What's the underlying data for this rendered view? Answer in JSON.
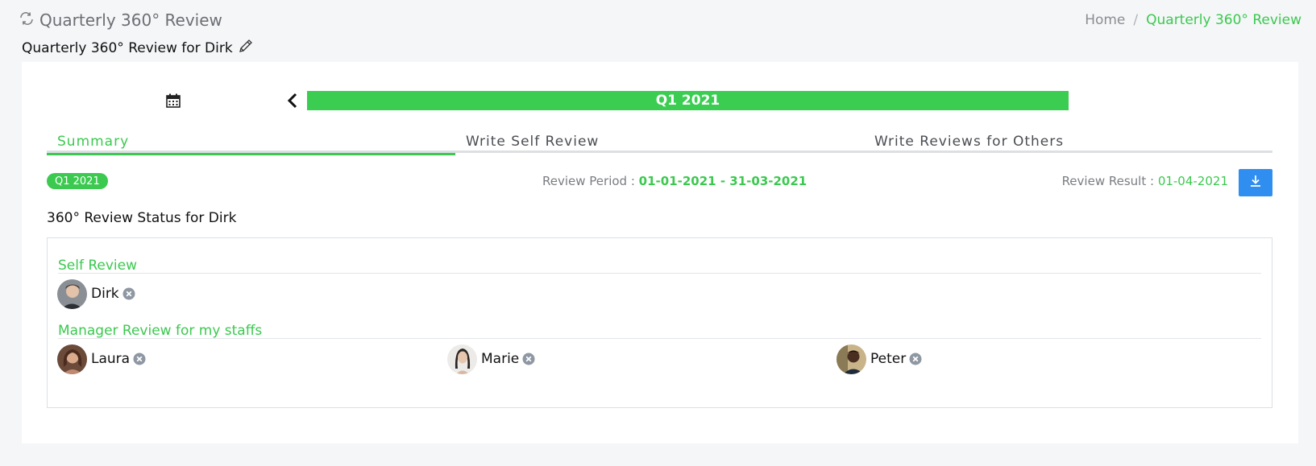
{
  "header": {
    "title": "Quarterly 360° Review",
    "breadcrumb": {
      "home": "Home",
      "separator": "/",
      "current": "Quarterly 360° Review"
    }
  },
  "subtitle": "Quarterly 360° Review for Dirk",
  "period_selector": {
    "label": "Q1 2021"
  },
  "tabs": [
    {
      "label": "Summary",
      "active": true
    },
    {
      "label": "Write Self Review",
      "active": false
    },
    {
      "label": "Write Reviews for Others",
      "active": false
    }
  ],
  "info": {
    "badge": "Q1 2021",
    "review_period_label": "Review Period :",
    "review_period_value": "01-01-2021 - 31-03-2021",
    "review_result_label": "Review Result :",
    "review_result_value": "01-04-2021"
  },
  "status_title": "360° Review Status for Dirk",
  "sections": {
    "self_review": {
      "label": "Self Review",
      "people": [
        {
          "name": "Dirk",
          "status": "not-completed"
        }
      ]
    },
    "manager_review": {
      "label": "Manager Review for my staffs",
      "people": [
        {
          "name": "Laura",
          "status": "not-completed"
        },
        {
          "name": "Marie",
          "status": "not-completed"
        },
        {
          "name": "Peter",
          "status": "not-completed"
        }
      ]
    }
  },
  "colors": {
    "accent": "#3bc94f",
    "period_bar": "#3bcd52",
    "download_button": "#2f8ef0",
    "status_icon": "#8e97a2"
  },
  "icons": {
    "title_icon": "refresh-cycle-icon",
    "edit": "pencil-icon",
    "calendar": "calendar-icon",
    "prev": "chevron-left-icon",
    "download": "download-icon",
    "status": "x-circle-icon"
  }
}
